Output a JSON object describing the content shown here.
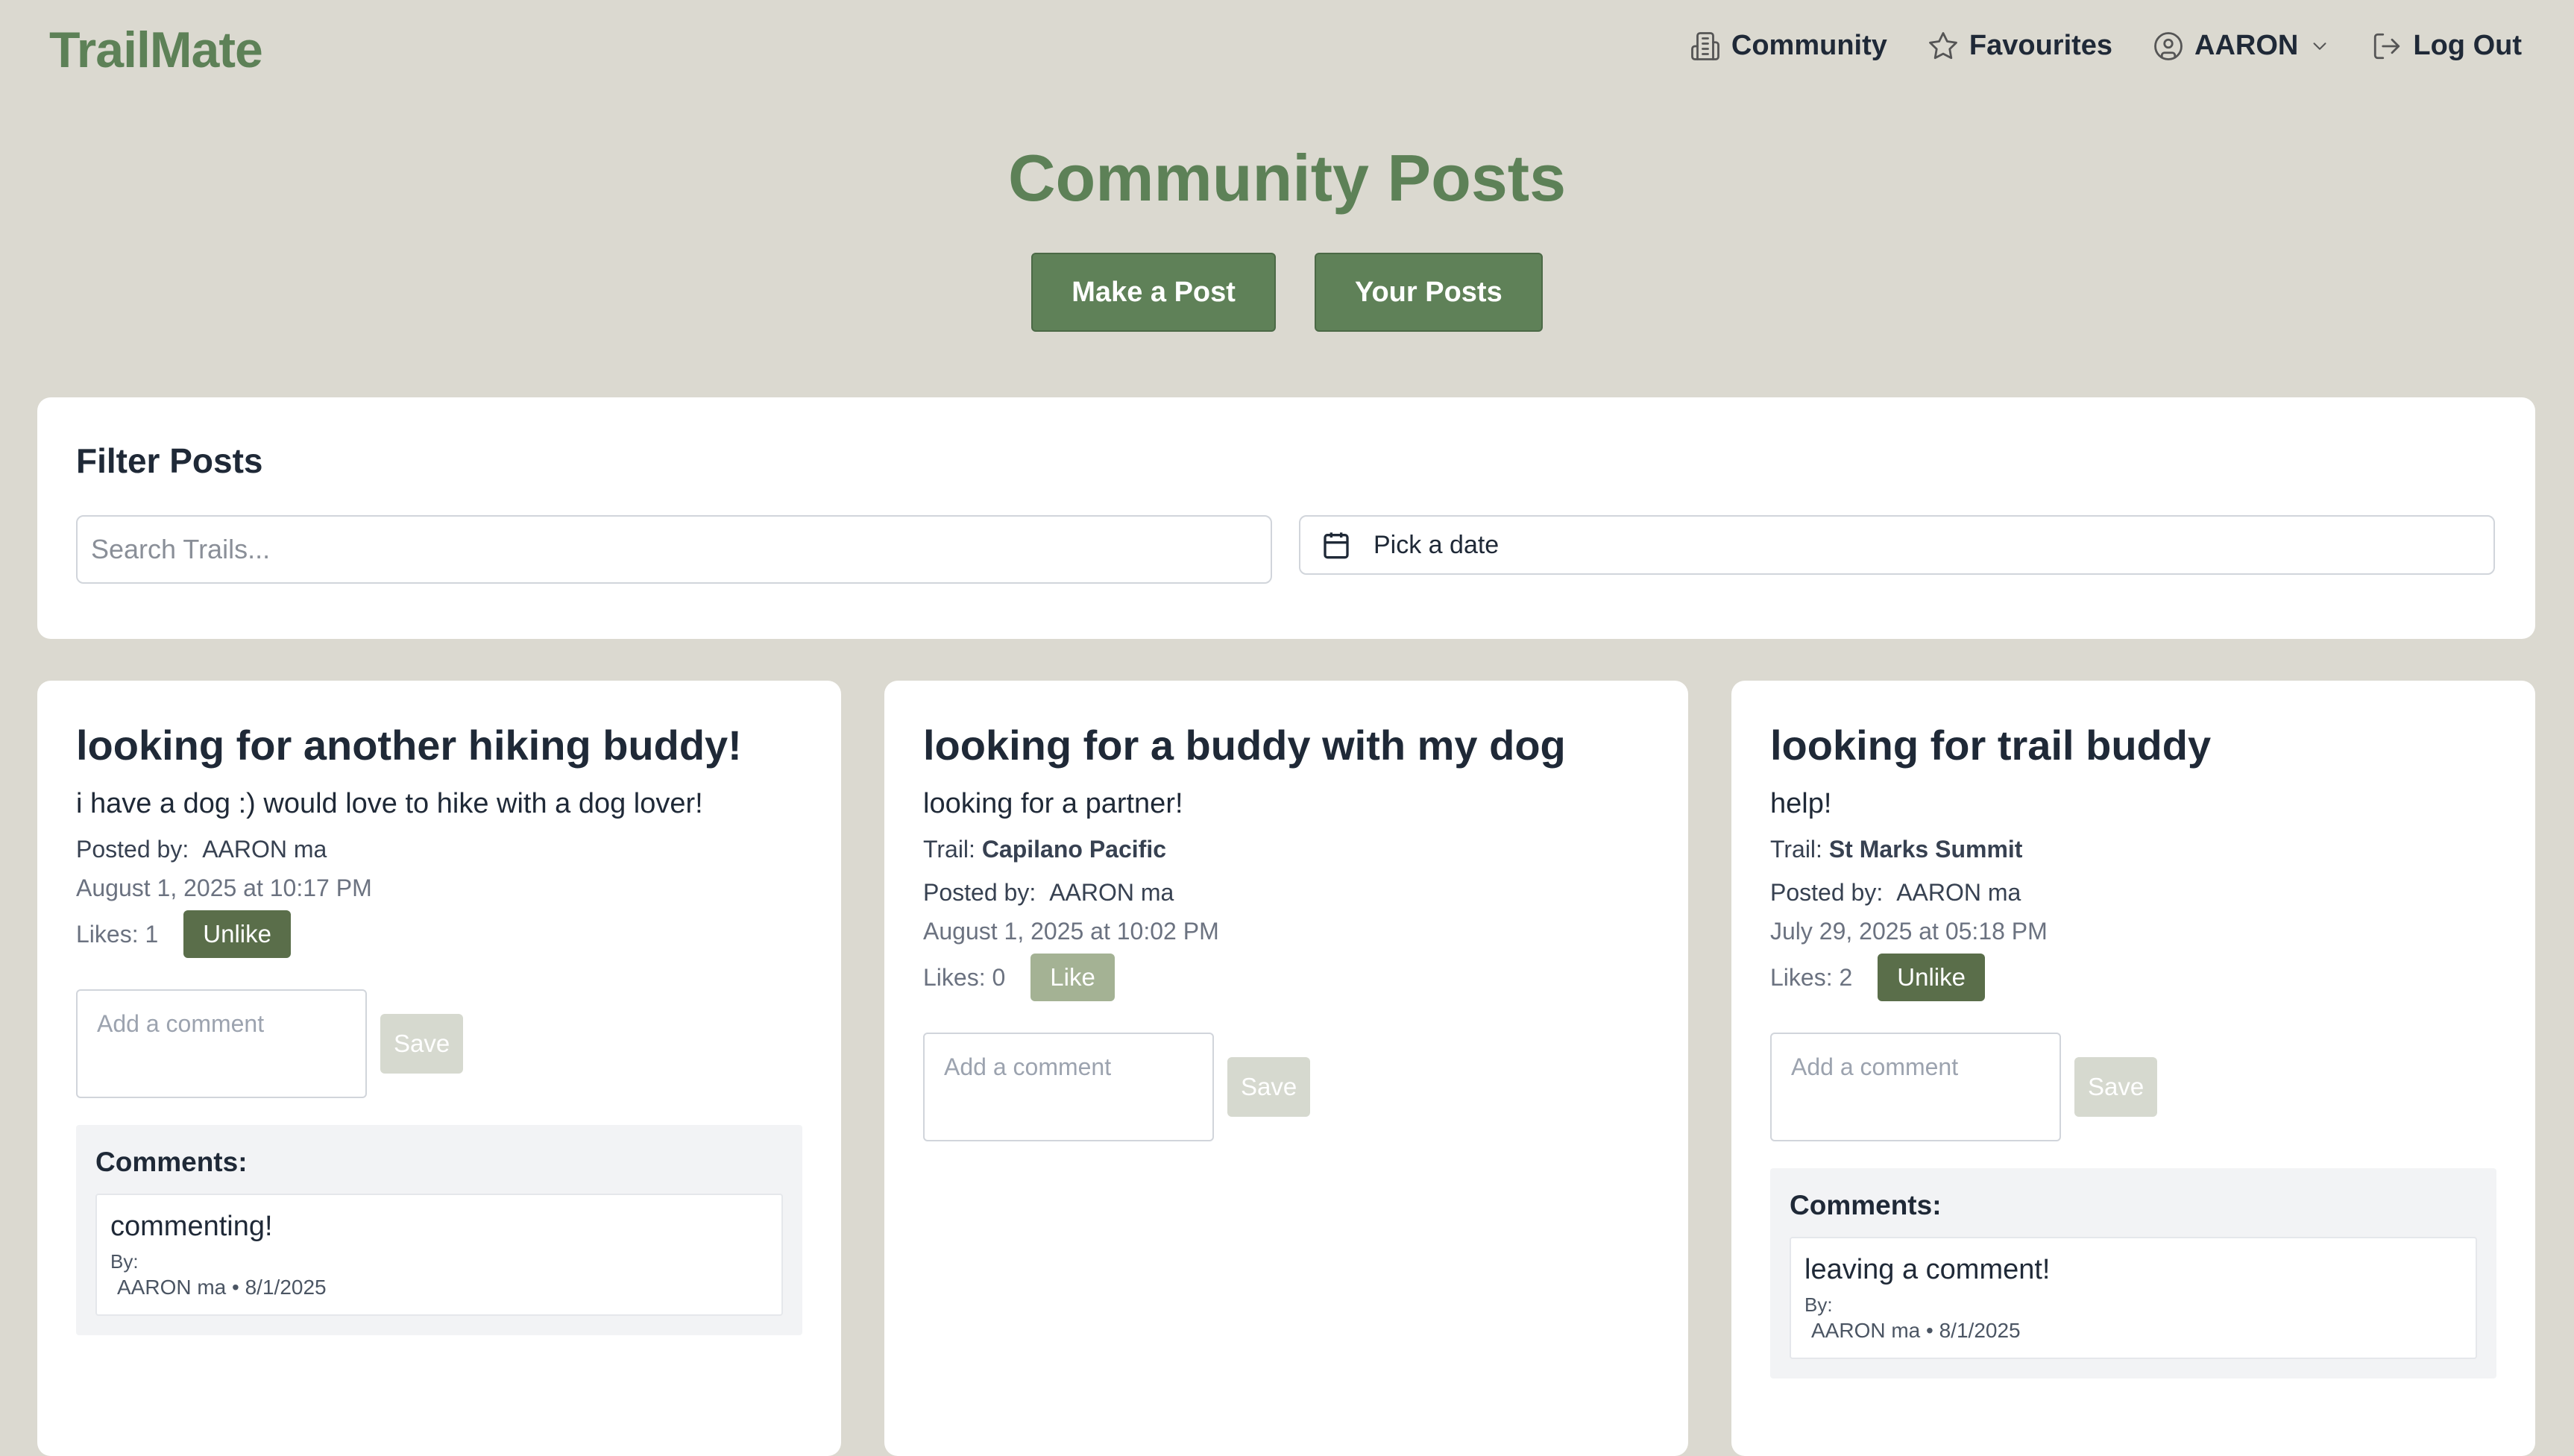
{
  "header": {
    "logo": "TrailMate",
    "nav": {
      "community": "Community",
      "favourites": "Favourites",
      "user": "AARON",
      "logout": "Log Out"
    }
  },
  "page": {
    "title": "Community Posts",
    "make_post": "Make a Post",
    "your_posts": "Your Posts"
  },
  "filter": {
    "title": "Filter Posts",
    "search_placeholder": "Search Trails...",
    "date_label": "Pick a date"
  },
  "labels": {
    "posted_by": "Posted by:",
    "trail": "Trail:",
    "comment_placeholder": "Add a comment",
    "save": "Save",
    "comments_heading": "Comments:",
    "by": "By:"
  },
  "posts": [
    {
      "title": "looking for another hiking buddy!",
      "body": "i have a dog :) would love to hike with a dog lover!",
      "trail": "",
      "author": "AARON ma",
      "date": "August 1, 2025 at 10:17 PM",
      "likes": "Likes: 1",
      "like_button": "Unlike",
      "comments": [
        {
          "text": "commenting!",
          "meta": "AARON ma • 8/1/2025"
        }
      ]
    },
    {
      "title": "looking for a buddy with my dog",
      "body": "looking for a partner!",
      "trail": "Capilano Pacific",
      "author": "AARON ma",
      "date": "August 1, 2025 at 10:02 PM",
      "likes": "Likes: 0",
      "like_button": "Like",
      "comments": []
    },
    {
      "title": "looking for trail buddy",
      "body": "help!",
      "trail": "St Marks Summit",
      "author": "AARON ma",
      "date": "July 29, 2025 at 05:18 PM",
      "likes": "Likes: 2",
      "like_button": "Unlike",
      "comments": [
        {
          "text": "leaving a comment!",
          "meta": "AARON ma • 8/1/2025"
        }
      ]
    }
  ],
  "colors": {
    "page_bg": "#dbd9d0",
    "brand_green": "#5d8157",
    "unlike_bg": "#5a6e4a",
    "like_bg": "#a4b294",
    "save_bg": "#d6d9cf"
  }
}
